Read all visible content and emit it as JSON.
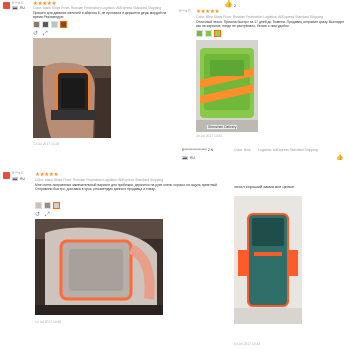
{
  "reviews": [
    {
      "stars": "★★★★★",
      "country_label": "RU",
      "meta": "Color: black  Ships From: Russian Federation  Logistics: AliExpress Standard Shipping",
      "text": "Пришёл для дамских мелочей и айфона 6, не пропахла и держится держ мордой на время Рекомендую",
      "date": "13 Jul 2017 13:28"
    },
    {
      "stars": "★★★★★",
      "meta": "Color: Blue  Ships From: Russian Federation  Logistics: AliExpress Standard Shipping",
      "text": "Отличный чехол. Пришла быстро за 17 дней до Тюмени. Продавец отправил сразу. Выглядит как на картинке, нигде не растрёпано, бегать с ним удобно",
      "date": "20 Jul 2017 13:52",
      "helpful": "2",
      "reviewer_masked": "R*****************  2 N",
      "reviewer_country": "RU",
      "tooltip": "Shenzhen Delivery",
      "meta2_color": "Color: Blue",
      "meta2_logistics": "Logistics: AliExpress Standard Shipping"
    },
    {
      "stars": "★★★★★",
      "country_label": "RU",
      "meta": "Color: black  Ships From: Russian Federation  Logistics: AliExpress Standard Shipping",
      "text": "Мне очень понравился замечательный вариант для пробежки, держится на руке очень хорошо на ощупь приятный. Отправили быстро, доставка в срок, рекомендую данного продавца и товар.",
      "date": "14 Jul 2017 14:56"
    },
    {
      "headline": "чехол хороший замки все целые",
      "date": "14 Jul 2017 10:43"
    }
  ]
}
